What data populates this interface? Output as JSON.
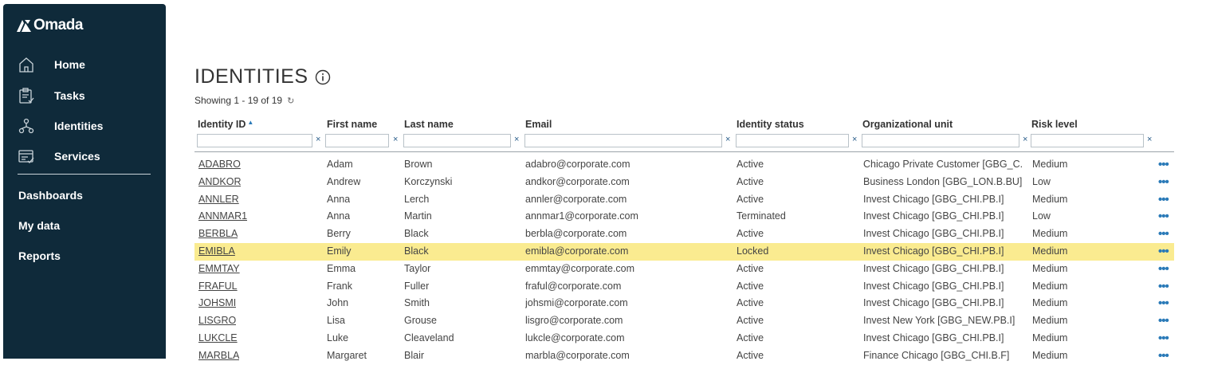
{
  "app": {
    "logo_text": "Omada"
  },
  "sidebar": {
    "nav": [
      {
        "label": "Home",
        "icon": "home-icon"
      },
      {
        "label": "Tasks",
        "icon": "tasks-icon"
      },
      {
        "label": "Identities",
        "icon": "identities-icon"
      },
      {
        "label": "Services",
        "icon": "services-icon"
      }
    ],
    "secondary": [
      {
        "label": "Dashboards"
      },
      {
        "label": "My data"
      },
      {
        "label": "Reports"
      }
    ]
  },
  "page": {
    "title": "IDENTITIES",
    "showing": "Showing 1 - 19 of 19"
  },
  "table": {
    "columns": [
      "Identity ID",
      "First name",
      "Last name",
      "Email",
      "Identity status",
      "Organizational unit",
      "Risk level"
    ],
    "filter_clear": "×",
    "more_label": "•••",
    "rows": [
      [
        "ADABRO",
        "Adam",
        "Brown",
        "adabro@corporate.com",
        "Active",
        "Chicago Private Customer [GBG_C...",
        "Medium"
      ],
      [
        "ANDKOR",
        "Andrew",
        "Korczynski",
        "andkor@corporate.com",
        "Active",
        "Business London [GBG_LON.B.BU]",
        "Low"
      ],
      [
        "ANNLER",
        "Anna",
        "Lerch",
        "annler@corporate.com",
        "Active",
        "Invest Chicago [GBG_CHI.PB.I]",
        "Medium"
      ],
      [
        "ANNMAR1",
        "Anna",
        "Martin",
        "annmar1@corporate.com",
        "Terminated",
        "Invest Chicago [GBG_CHI.PB.I]",
        "Low"
      ],
      [
        "BERBLA",
        "Berry",
        "Black",
        "berbla@corporate.com",
        "Active",
        "Invest Chicago [GBG_CHI.PB.I]",
        "Medium"
      ],
      [
        "EMIBLA",
        "Emily",
        "Black",
        "emibla@corporate.com",
        "Locked",
        "Invest Chicago [GBG_CHI.PB.I]",
        "Medium"
      ],
      [
        "EMMTAY",
        "Emma",
        "Taylor",
        "emmtay@corporate.com",
        "Active",
        "Invest Chicago [GBG_CHI.PB.I]",
        "Medium"
      ],
      [
        "FRAFUL",
        "Frank",
        "Fuller",
        "fraful@corporate.com",
        "Active",
        "Invest Chicago [GBG_CHI.PB.I]",
        "Medium"
      ],
      [
        "JOHSMI",
        "John",
        "Smith",
        "johsmi@corporate.com",
        "Active",
        "Invest Chicago [GBG_CHI.PB.I]",
        "Medium"
      ],
      [
        "LISGRO",
        "Lisa",
        "Grouse",
        "lisgro@corporate.com",
        "Active",
        "Invest New York [GBG_NEW.PB.I]",
        "Medium"
      ],
      [
        "LUKCLE",
        "Luke",
        "Cleaveland",
        "lukcle@corporate.com",
        "Active",
        "Invest Chicago [GBG_CHI.PB.I]",
        "Medium"
      ],
      [
        "MARBLA",
        "Margaret",
        "Blair",
        "marbla@corporate.com",
        "Active",
        "Finance Chicago [GBG_CHI.B.F]",
        "Medium"
      ]
    ],
    "highlighted_row": 5
  },
  "colors": {
    "sidebar_bg": "#0f2a3a",
    "highlight": "#faeb90",
    "accent": "#2a7ab8"
  }
}
